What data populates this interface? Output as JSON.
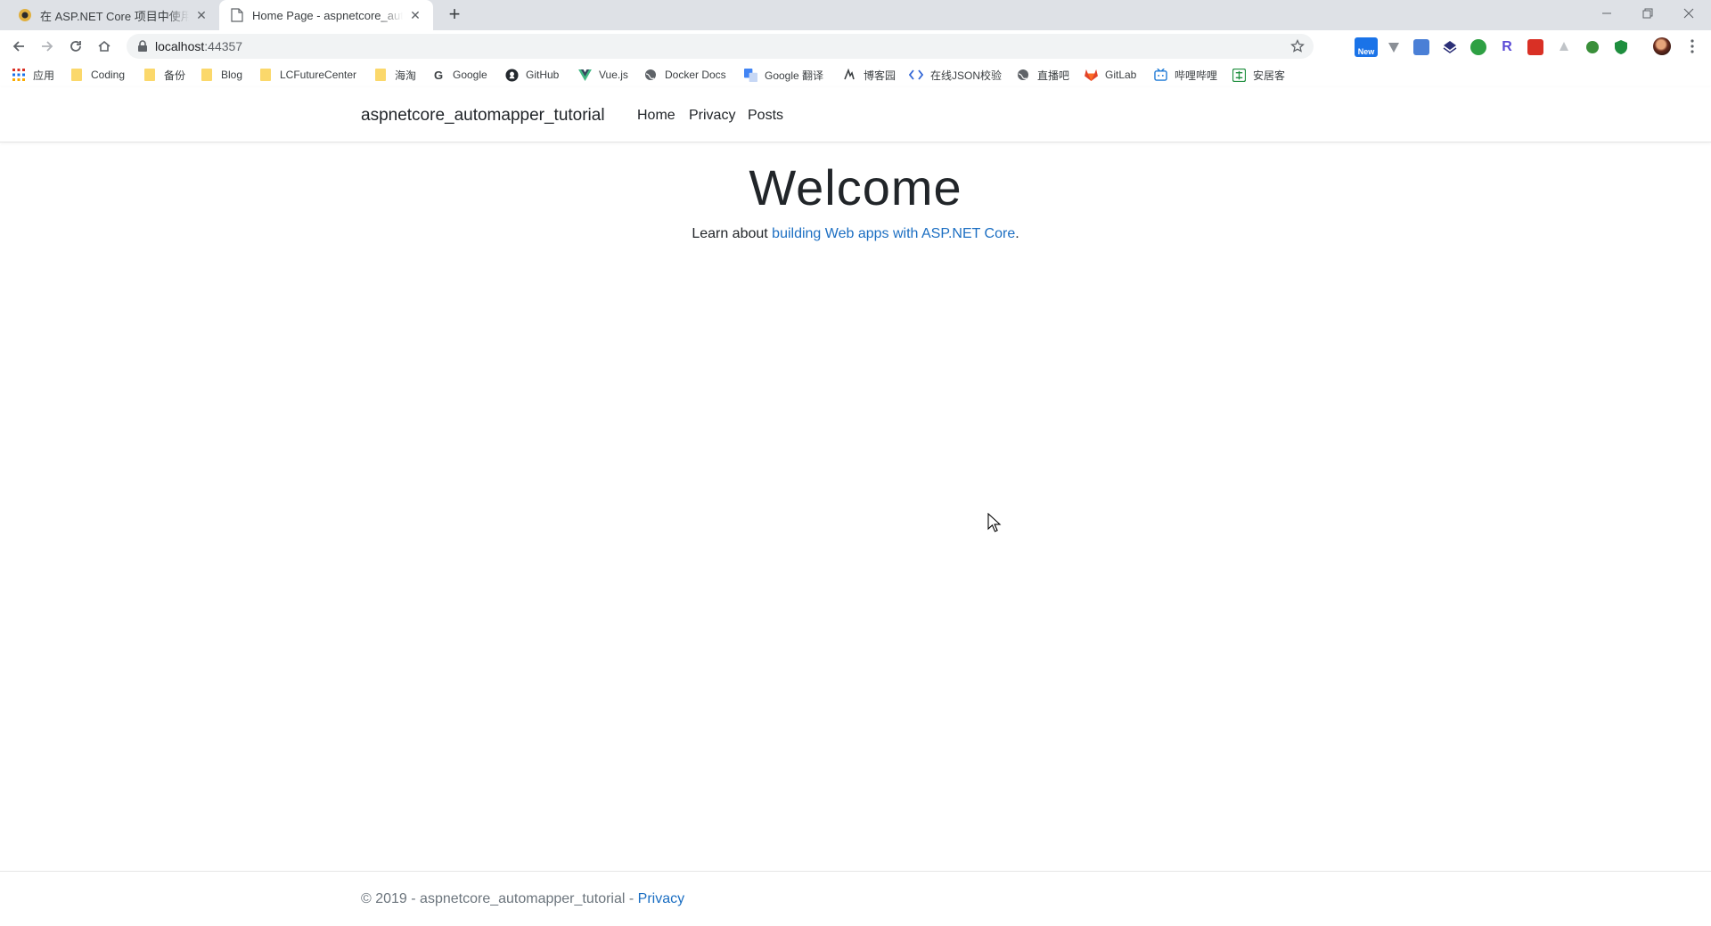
{
  "browser": {
    "tabs": [
      {
        "title": "在 ASP.NET Core 项目中使用 AutoMapper",
        "favicon": "blog-favicon-icon",
        "active": false
      },
      {
        "title": "Home Page - aspnetcore_automapper_tutorial",
        "favicon": "page-favicon-icon",
        "active": true
      }
    ],
    "new_tab_label": "+",
    "address": {
      "host": "localhost",
      "port": ":44357"
    },
    "bookmarks": [
      {
        "label": "应用",
        "icon": "apps-grid-icon"
      },
      {
        "label": "Coding",
        "icon": "folder-icon"
      },
      {
        "label": "备份",
        "icon": "folder-icon"
      },
      {
        "label": "Blog",
        "icon": "folder-icon"
      },
      {
        "label": "LCFutureCenter",
        "icon": "folder-icon"
      },
      {
        "label": "海淘",
        "icon": "folder-icon"
      },
      {
        "label": "Google",
        "icon": "google-icon"
      },
      {
        "label": "GitHub",
        "icon": "github-icon"
      },
      {
        "label": "Vue.js",
        "icon": "vue-icon"
      },
      {
        "label": "Docker Docs",
        "icon": "globe-icon"
      },
      {
        "label": "Google 翻译",
        "icon": "translate-icon"
      },
      {
        "label": "博客园",
        "icon": "cnblogs-icon"
      },
      {
        "label": "在线JSON校验",
        "icon": "code-icon"
      },
      {
        "label": "直播吧",
        "icon": "globe-icon"
      },
      {
        "label": "GitLab",
        "icon": "gitlab-icon"
      },
      {
        "label": "哔哩哔哩",
        "icon": "bilibili-icon"
      },
      {
        "label": "安居客",
        "icon": "anjuke-icon"
      }
    ],
    "extension_badge": "New"
  },
  "site": {
    "brand": "aspnetcore_automapper_tutorial",
    "nav": [
      "Home",
      "Privacy",
      "Posts"
    ],
    "hero": {
      "title": "Welcome",
      "lead": "Learn about ",
      "link": "building Web apps with ASP.NET Core",
      "trail": "."
    },
    "footer": {
      "text": "© 2019 - aspnetcore_automapper_tutorial - ",
      "link": "Privacy"
    }
  },
  "colors": {
    "link": "#1b6ec2",
    "text": "#212529",
    "muted": "#6c757d",
    "tabstrip": "#dee1e6"
  }
}
